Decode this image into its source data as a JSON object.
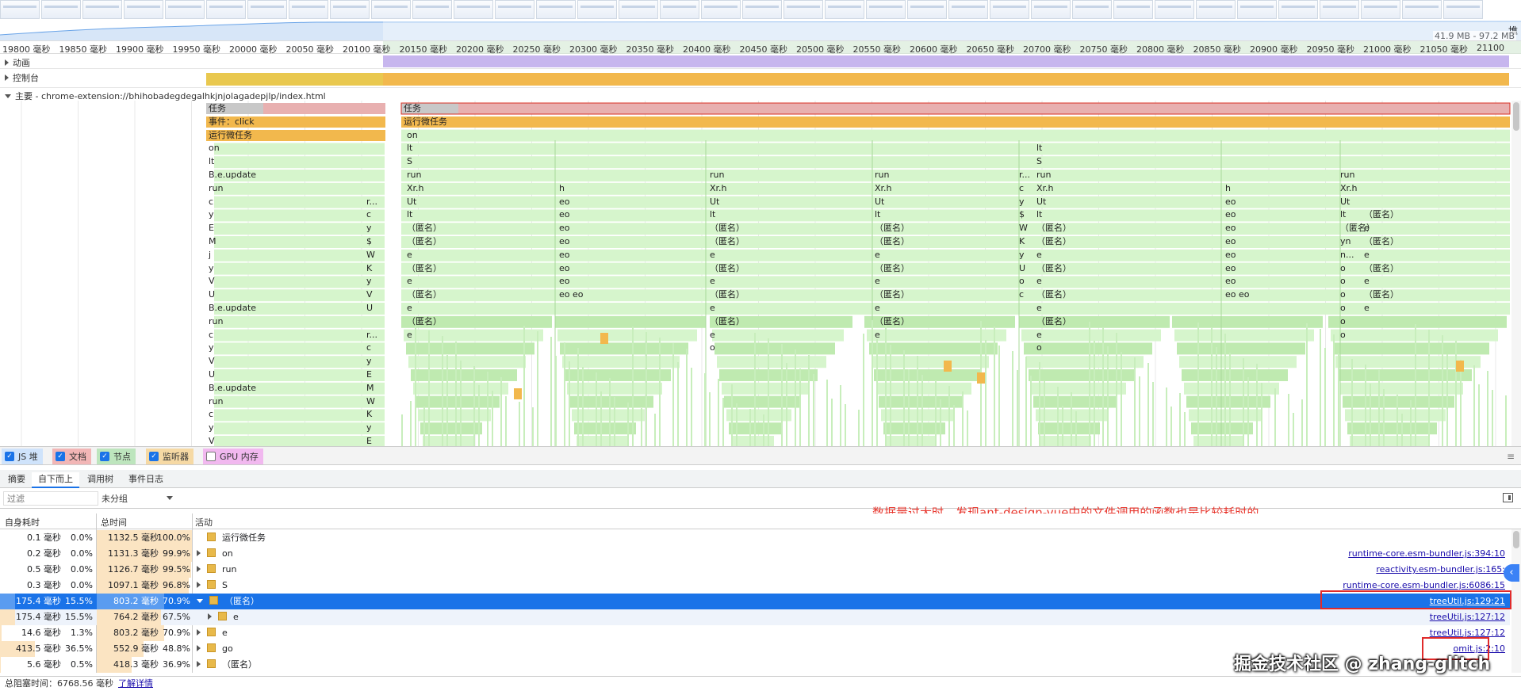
{
  "overview": {
    "heap_range": "41.9 MB - 97.2 MB",
    "heap_corner": "堆"
  },
  "ruler": {
    "ticks": [
      "19800 毫秒",
      "19850 毫秒",
      "19900 毫秒",
      "19950 毫秒",
      "20000 毫秒",
      "20050 毫秒",
      "20100 毫秒",
      "20150 毫秒",
      "20200 毫秒",
      "20250 毫秒",
      "20300 毫秒",
      "20350 毫秒",
      "20400 毫秒",
      "20450 毫秒",
      "20500 毫秒",
      "20550 毫秒",
      "20600 毫秒",
      "20650 毫秒",
      "20700 毫秒",
      "20750 毫秒",
      "20800 毫秒",
      "20850 毫秒",
      "20900 毫秒",
      "20950 毫秒",
      "21000 毫秒",
      "21050 毫秒",
      "21100"
    ]
  },
  "tracks": {
    "animation": "动画",
    "console": "控制台",
    "main": "主要 - chrome-extension://bhihobadegdegalhkjnjolagadepjlp/index.html"
  },
  "flame": {
    "left_stack": [
      "任务",
      "事件：click",
      "运行微任务",
      "on",
      "lt",
      "B.e.update",
      "run",
      "c",
      "y",
      "E",
      "M",
      "j",
      "y",
      "V",
      "U",
      "B.e.update",
      "run",
      "c",
      "y",
      "V",
      "U",
      "B.e.update",
      "run",
      "c",
      "y",
      "V"
    ],
    "mid_stack": [
      "",
      "",
      "",
      "",
      "",
      "",
      "r...",
      "c",
      "y",
      "$",
      "W",
      "K",
      "y",
      "V",
      "U",
      "",
      "r...",
      "c",
      "y",
      "E",
      "M",
      "W",
      "K",
      "y",
      "E"
    ],
    "right_task": "任务",
    "right_micro": "运行微任务",
    "col1": [
      "on",
      "lt",
      "S",
      "run",
      "Xr.h",
      "Ut",
      "lt",
      "（匿名）",
      "（匿名）",
      "e",
      "（匿名）",
      "e",
      "（匿名）",
      "e",
      "（匿名）",
      "e"
    ],
    "col2": [
      "h",
      "eo",
      "eo",
      "eo",
      "eo",
      "eo",
      "eo",
      "eo",
      "eo  eo"
    ],
    "col3": [
      "run",
      "Xr.h",
      "Ut",
      "lt",
      "（匿名）",
      "（匿名）",
      "e",
      "（匿名）",
      "e",
      "（匿名）",
      "e",
      "（匿名）",
      "e",
      "o"
    ],
    "col4": [
      "run",
      "Xr.h",
      "Ut",
      "lt",
      "（匿名）",
      "（匿名）",
      "e",
      "（匿名）",
      "e",
      "（匿名）",
      "e",
      "（匿名）",
      "e"
    ],
    "col5": [
      "lt",
      "S",
      "run",
      "Xr.h",
      "Ut",
      "lt",
      "（匿名）",
      "（匿名）",
      "e",
      "（匿名）",
      "e",
      "（匿名）",
      "e",
      "（匿名）",
      "e",
      "o"
    ],
    "col5b": [
      "r...",
      "c",
      "y",
      "$",
      "W",
      "K",
      "y",
      "U",
      "o",
      "c"
    ],
    "col6": [
      "h",
      "eo",
      "eo",
      "eo",
      "eo",
      "eo",
      "eo",
      "eo",
      "eo  eo"
    ],
    "col7": [
      "run",
      "Xr.h",
      "Ut",
      "lt",
      "（匿名）",
      "yn",
      "n...",
      "o",
      "o",
      "o",
      "o",
      "o",
      "o"
    ],
    "col7b": [
      "（匿名）",
      "e",
      "（匿名）",
      "e",
      "（匿名）",
      "e",
      "（匿名）",
      "e"
    ]
  },
  "checkboxes": [
    {
      "label": "JS 堆",
      "checked": true,
      "color": "#cfe3fb"
    },
    {
      "label": "文档",
      "checked": true,
      "color": "#f2b6b6"
    },
    {
      "label": "节点",
      "checked": true,
      "color": "#bde5bd"
    },
    {
      "label": "监听器",
      "checked": true,
      "color": "#f6d9a4"
    },
    {
      "label": "GPU 内存",
      "checked": false,
      "color": "#f1b8ef"
    }
  ],
  "tabs": [
    "摘要",
    "自下而上",
    "调用树",
    "事件日志"
  ],
  "active_tab": "自下而上",
  "filter": {
    "placeholder": "过滤",
    "group": "未分组"
  },
  "annotation": "数据量过大时，发现ant-design-vue中的文件调用的函数也是比较耗时的。",
  "table": {
    "headers": {
      "self": "自身耗时",
      "total": "总时间",
      "activity": "活动"
    },
    "rows": [
      {
        "self_ms": "0.1 毫秒",
        "self_pct": "0.0%",
        "self_frac": 0.0,
        "total_ms": "1132.5 毫秒",
        "total_pct": "100.0%",
        "total_frac": 1.0,
        "name": "运行微任务",
        "expand": "none",
        "indent": 0,
        "source": ""
      },
      {
        "self_ms": "0.2 毫秒",
        "self_pct": "0.0%",
        "self_frac": 0.0,
        "total_ms": "1131.3 毫秒",
        "total_pct": "99.9%",
        "total_frac": 0.999,
        "name": "on",
        "expand": "right",
        "indent": 0,
        "source": "runtime-core.esm-bundler.js:394:10"
      },
      {
        "self_ms": "0.5 毫秒",
        "self_pct": "0.0%",
        "self_frac": 0.0,
        "total_ms": "1126.7 毫秒",
        "total_pct": "99.5%",
        "total_frac": 0.995,
        "name": "run",
        "expand": "right",
        "indent": 0,
        "source": "reactivity.esm-bundler.js:165:"
      },
      {
        "self_ms": "0.3 毫秒",
        "self_pct": "0.0%",
        "self_frac": 0.0,
        "total_ms": "1097.1 毫秒",
        "total_pct": "96.8%",
        "total_frac": 0.968,
        "name": "S",
        "expand": "right",
        "indent": 0,
        "source": "runtime-core.esm-bundler.js:6086:15"
      },
      {
        "self_ms": "175.4 毫秒",
        "self_pct": "15.5%",
        "self_frac": 0.155,
        "total_ms": "803.2 毫秒",
        "total_pct": "70.9%",
        "total_frac": 0.709,
        "name": "（匿名）",
        "expand": "down",
        "indent": 0,
        "source": "treeUtil.js:129:21",
        "selected": true
      },
      {
        "self_ms": "175.4 毫秒",
        "self_pct": "15.5%",
        "self_frac": 0.155,
        "total_ms": "764.2 毫秒",
        "total_pct": "67.5%",
        "total_frac": 0.675,
        "name": "e",
        "expand": "right",
        "indent": 1,
        "source": "treeUtil.js:127:12",
        "sub": true
      },
      {
        "self_ms": "14.6 毫秒",
        "self_pct": "1.3%",
        "self_frac": 0.013,
        "total_ms": "803.2 毫秒",
        "total_pct": "70.9%",
        "total_frac": 0.709,
        "name": "e",
        "expand": "right",
        "indent": 0,
        "source": "treeUtil.js:127:12"
      },
      {
        "self_ms": "413.5 毫秒",
        "self_pct": "36.5%",
        "self_frac": 0.365,
        "total_ms": "552.9 毫秒",
        "total_pct": "48.8%",
        "total_frac": 0.488,
        "name": "go",
        "expand": "right",
        "indent": 0,
        "source": "omit.js:2:10"
      },
      {
        "self_ms": "5.6 毫秒",
        "self_pct": "0.5%",
        "self_frac": 0.005,
        "total_ms": "418.3 毫秒",
        "total_pct": "36.9%",
        "total_frac": 0.369,
        "name": "（匿名）",
        "expand": "right",
        "indent": 0,
        "source": ""
      }
    ]
  },
  "footer": {
    "blocking": "总阻塞时间：6768.56 毫秒",
    "learn_more": "了解详情"
  },
  "watermark": "掘金技术社区 @ zhang-glitch"
}
